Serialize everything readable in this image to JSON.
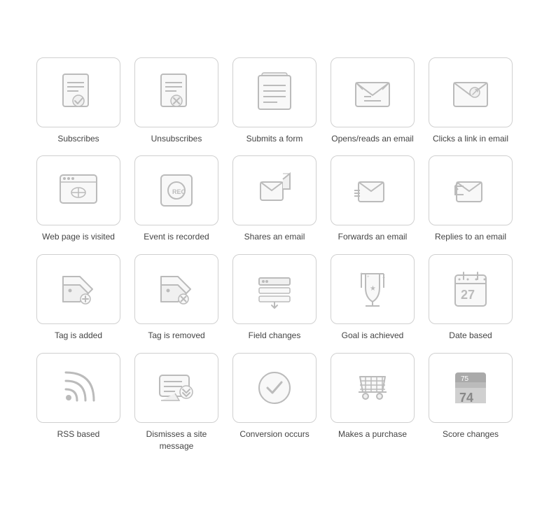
{
  "tiles": [
    {
      "name": "subscribes",
      "label": "Subscribes"
    },
    {
      "name": "unsubscribes",
      "label": "Unsubscribes"
    },
    {
      "name": "submits-form",
      "label": "Submits a form"
    },
    {
      "name": "opens-reads-email",
      "label": "Opens/reads an email"
    },
    {
      "name": "clicks-link-email",
      "label": "Clicks a link in email"
    },
    {
      "name": "web-page-visited",
      "label": "Web page is visited"
    },
    {
      "name": "event-recorded",
      "label": "Event is recorded"
    },
    {
      "name": "shares-email",
      "label": "Shares an email"
    },
    {
      "name": "forwards-email",
      "label": "Forwards an email"
    },
    {
      "name": "replies-email",
      "label": "Replies to an email"
    },
    {
      "name": "tag-added",
      "label": "Tag is added"
    },
    {
      "name": "tag-removed",
      "label": "Tag is removed"
    },
    {
      "name": "field-changes",
      "label": "Field changes"
    },
    {
      "name": "goal-achieved",
      "label": "Goal is achieved"
    },
    {
      "name": "date-based",
      "label": "Date based"
    },
    {
      "name": "rss-based",
      "label": "RSS based"
    },
    {
      "name": "dismisses-site-message",
      "label": "Dismisses a site message"
    },
    {
      "name": "conversion-occurs",
      "label": "Conversion occurs"
    },
    {
      "name": "makes-purchase",
      "label": "Makes a purchase"
    },
    {
      "name": "score-changes",
      "label": "Score changes"
    }
  ]
}
